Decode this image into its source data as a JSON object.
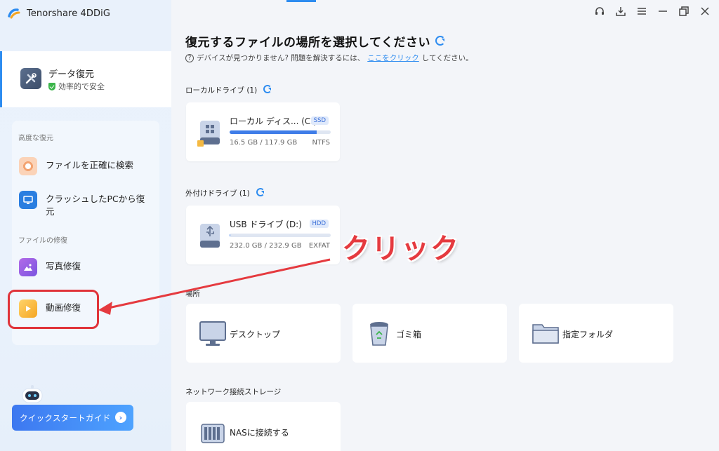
{
  "app": {
    "brand": "Tenorshare 4DDiG"
  },
  "sidebar": {
    "primary": {
      "title": "データ復元",
      "subtitle": "効率的で安全"
    },
    "section_advanced": "高度な復元",
    "items_advanced": [
      {
        "label": "ファイルを正確に検索"
      },
      {
        "label_line1": "クラッシュしたPCから復",
        "label_line2": "元"
      }
    ],
    "section_repair": "ファイルの修復",
    "items_repair": [
      {
        "label": "写真修復"
      },
      {
        "label": "動画修復"
      }
    ],
    "quick_start": "クイックスタートガイド"
  },
  "main": {
    "title": "復元するファイルの場所を選択してください",
    "hint_prefix": "デバイスが見つかりません? 問題を解決するには、",
    "hint_link": "ここをクリック",
    "hint_suffix": "してください。",
    "local_label": "ローカルドライブ (1)",
    "external_label": "外付けドライブ (1)",
    "location_label": "場所",
    "network_label": "ネットワーク接続ストレージ",
    "drives": [
      {
        "name": "ローカル ディス... (C:)",
        "type": "SSD",
        "size": "16.5 GB / 117.9 GB",
        "fs": "NTFS",
        "usage": 0.86
      },
      {
        "name": "USB ドライブ (D:)",
        "type": "HDD",
        "size": "232.0 GB / 232.9 GB",
        "fs": "EXFAT",
        "usage": 0.01
      }
    ],
    "locations": [
      {
        "label": "デスクトップ",
        "icon": "monitor-icon"
      },
      {
        "label": "ゴミ箱",
        "icon": "trash-icon"
      },
      {
        "label": "指定フォルダ",
        "icon": "folder-icon"
      }
    ],
    "nas": {
      "label": "NASに接続する",
      "icon": "nas-icon"
    }
  },
  "annotation": {
    "text": "クリック",
    "color": "#e53a3f"
  }
}
